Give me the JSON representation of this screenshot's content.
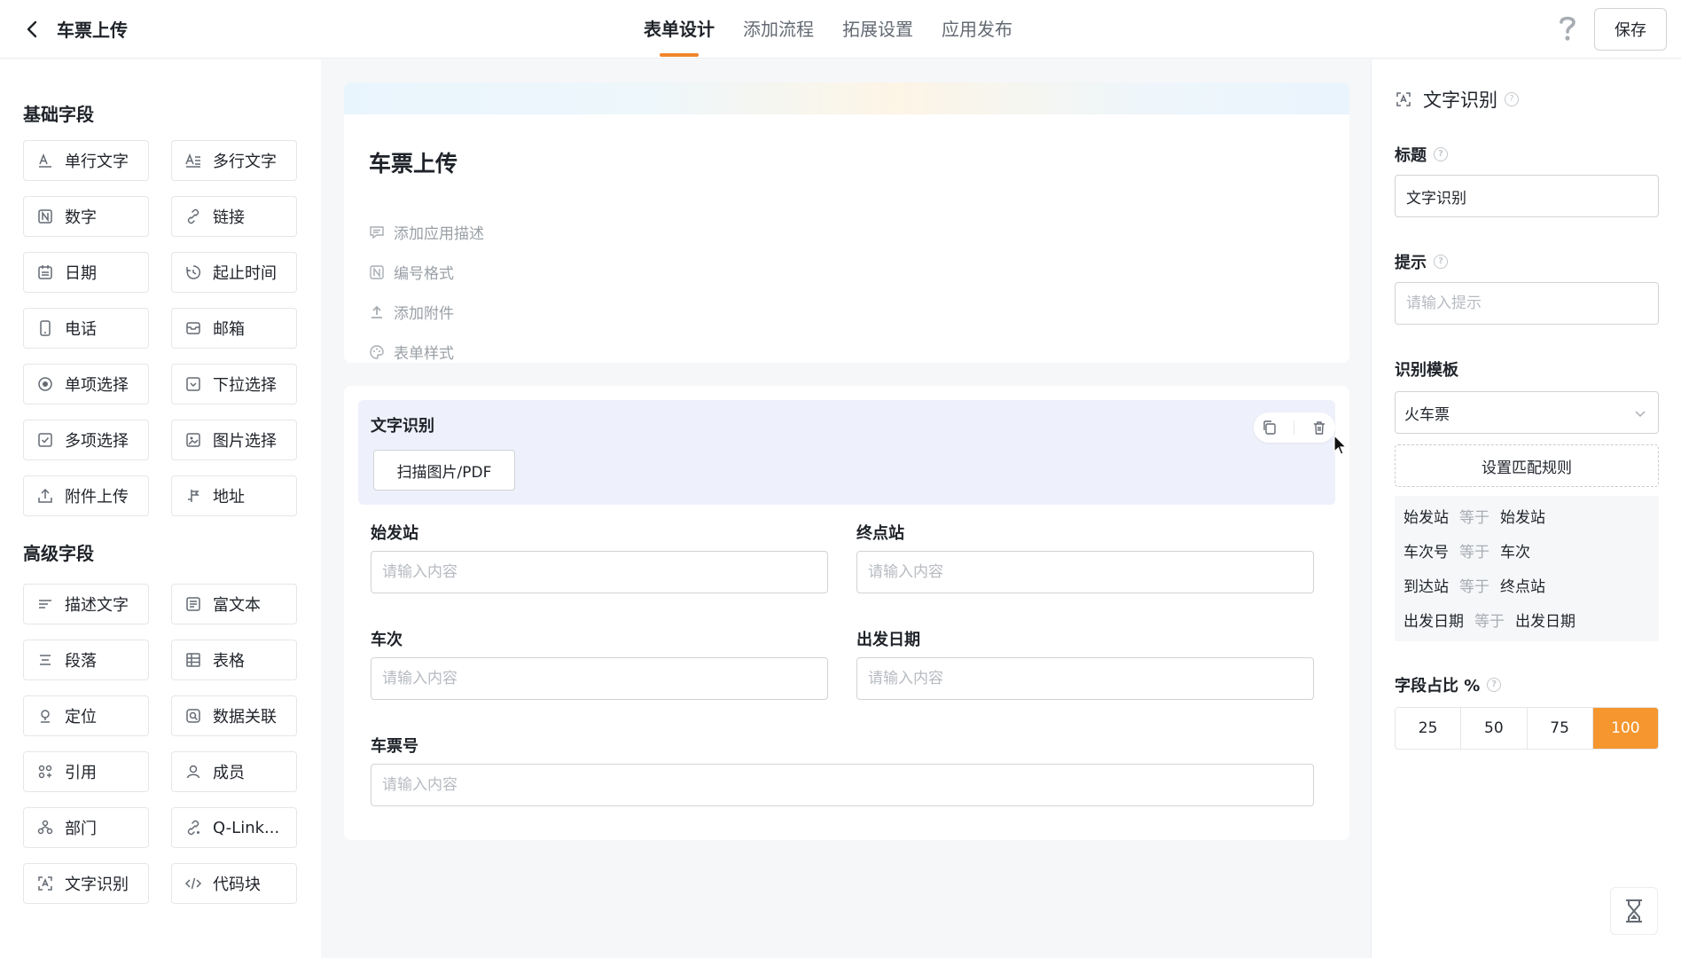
{
  "header": {
    "title": "车票上传",
    "tabs": [
      {
        "label": "表单设计",
        "active": true
      },
      {
        "label": "添加流程",
        "active": false
      },
      {
        "label": "拓展设置",
        "active": false
      },
      {
        "label": "应用发布",
        "active": false
      }
    ],
    "save_label": "保存",
    "accent": "#f2852b"
  },
  "palette": {
    "basic_title": "基础字段",
    "basic": [
      {
        "label": "单行文字",
        "icon": "single-line-text-icon"
      },
      {
        "label": "多行文字",
        "icon": "multi-line-text-icon"
      },
      {
        "label": "数字",
        "icon": "number-icon"
      },
      {
        "label": "链接",
        "icon": "link-icon"
      },
      {
        "label": "日期",
        "icon": "calendar-icon"
      },
      {
        "label": "起止时间",
        "icon": "time-range-icon"
      },
      {
        "label": "电话",
        "icon": "phone-icon"
      },
      {
        "label": "邮箱",
        "icon": "mail-icon"
      },
      {
        "label": "单项选择",
        "icon": "radio-icon"
      },
      {
        "label": "下拉选择",
        "icon": "dropdown-icon"
      },
      {
        "label": "多项选择",
        "icon": "checkbox-icon"
      },
      {
        "label": "图片选择",
        "icon": "image-icon"
      },
      {
        "label": "附件上传",
        "icon": "upload-icon"
      },
      {
        "label": "地址",
        "icon": "address-icon"
      }
    ],
    "advanced_title": "高级字段",
    "advanced": [
      {
        "label": "描述文字",
        "icon": "description-icon"
      },
      {
        "label": "富文本",
        "icon": "rich-text-icon"
      },
      {
        "label": "段落",
        "icon": "paragraph-icon"
      },
      {
        "label": "表格",
        "icon": "table-icon"
      },
      {
        "label": "定位",
        "icon": "location-icon"
      },
      {
        "label": "数据关联",
        "icon": "data-link-icon"
      },
      {
        "label": "引用",
        "icon": "reference-icon"
      },
      {
        "label": "成员",
        "icon": "member-icon"
      },
      {
        "label": "部门",
        "icon": "department-icon"
      },
      {
        "label": "Q-Link...",
        "icon": "q-link-icon"
      },
      {
        "label": "文字识别",
        "icon": "ocr-icon"
      },
      {
        "label": "代码块",
        "icon": "code-icon"
      }
    ]
  },
  "form": {
    "title": "车票上传",
    "meta": [
      {
        "label": "添加应用描述",
        "icon": "comment-icon"
      },
      {
        "label": "编号格式",
        "icon": "number-format-icon"
      },
      {
        "label": "添加附件",
        "icon": "attach-upload-icon"
      },
      {
        "label": "表单样式",
        "icon": "palette-icon"
      }
    ],
    "ocr_label": "文字识别",
    "scan_button": "扫描图片/PDF",
    "fields": {
      "from_label": "始发站",
      "to_label": "终点站",
      "train_label": "车次",
      "date_label": "出发日期",
      "ticket_label": "车票号",
      "placeholder": "请输入内容"
    }
  },
  "props": {
    "heading": "文字识别",
    "title_label": "标题",
    "title_value": "文字识别",
    "hint_label": "提示",
    "hint_placeholder": "请输入提示",
    "template_label": "识别模板",
    "template_value": "火车票",
    "rule_button": "设置匹配规则",
    "rules": [
      {
        "field": "始发站",
        "op": "等于",
        "target": "始发站"
      },
      {
        "field": "车次号",
        "op": "等于",
        "target": "车次"
      },
      {
        "field": "到达站",
        "op": "等于",
        "target": "终点站"
      },
      {
        "field": "出发日期",
        "op": "等于",
        "target": "出发日期"
      }
    ],
    "width_label": "字段占比 %",
    "width_options": [
      "25",
      "50",
      "75",
      "100"
    ],
    "width_selected": "100",
    "selected_color": "#f5962f"
  }
}
